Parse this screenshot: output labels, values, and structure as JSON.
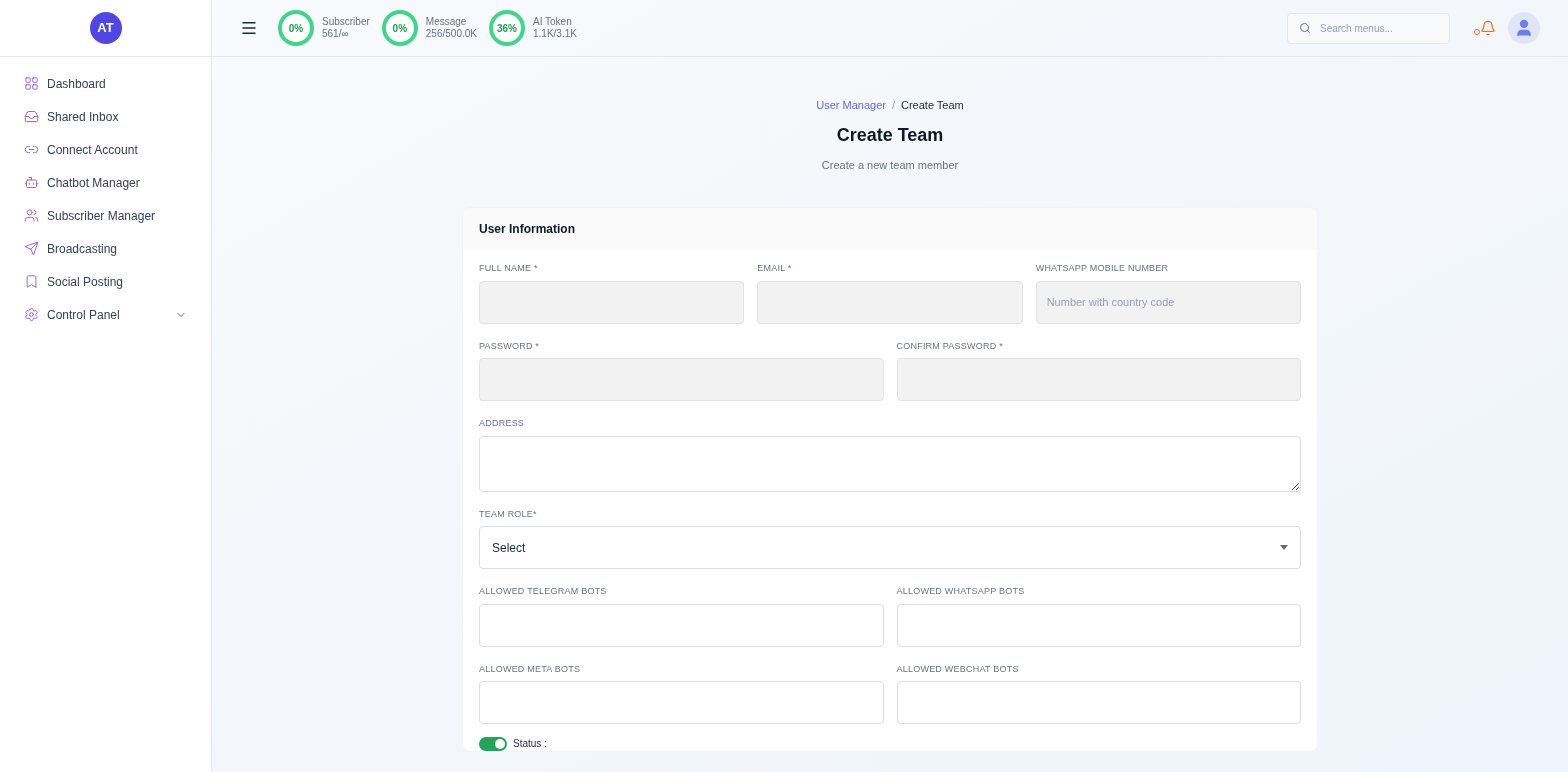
{
  "sidebar": {
    "avatar": "AT",
    "items": [
      {
        "label": "Dashboard",
        "expandable": false
      },
      {
        "label": "Shared Inbox",
        "expandable": false
      },
      {
        "label": "Connect Account",
        "expandable": false
      },
      {
        "label": "Chatbot Manager",
        "expandable": false
      },
      {
        "label": "Subscriber Manager",
        "expandable": false
      },
      {
        "label": "Broadcasting",
        "expandable": false
      },
      {
        "label": "Social Posting",
        "expandable": false
      },
      {
        "label": "Control Panel",
        "expandable": true
      }
    ]
  },
  "header": {
    "stats": [
      {
        "percent": "0%",
        "label": "Subscriber",
        "value": "561/∞"
      },
      {
        "percent": "0%",
        "label": "Message",
        "value": "256/500.0K"
      },
      {
        "percent": "36%",
        "label": "AI Token",
        "value": "1.1K/3.1K"
      }
    ],
    "search": {
      "placeholder": "Search menus..."
    }
  },
  "breadcrumb": [
    {
      "label": "User Manager",
      "link": true
    },
    {
      "label": "Create Team",
      "link": false
    }
  ],
  "breadcrumb_separator": "/",
  "title": "Create Team",
  "subtitle": "Create a new team member",
  "card": {
    "title": "User Information",
    "rows": [
      [
        {
          "label": "FULL NAME *",
          "kind": "input",
          "filled": true
        },
        {
          "label": "EMAIL *",
          "kind": "input",
          "filled": true
        },
        {
          "label": "WHATSAPP MOBILE NUMBER",
          "kind": "input",
          "filled": true,
          "placeholder": "Number with country code"
        }
      ],
      [
        {
          "label": "PASSWORD *",
          "kind": "input",
          "filled": true
        },
        {
          "label": "CONFIRM PASSWORD *",
          "kind": "input",
          "filled": true
        }
      ],
      [
        {
          "label": "ADDRESS",
          "kind": "textarea",
          "filled": false
        }
      ],
      [
        {
          "label": "TEAM ROLE*",
          "kind": "select",
          "filled": false,
          "value": "Select"
        }
      ],
      [
        {
          "label": "ALLOWED TELEGRAM BOTS",
          "kind": "input",
          "filled": false
        },
        {
          "label": "ALLOWED WHATSAPP BOTS",
          "kind": "input",
          "filled": false
        }
      ],
      [
        {
          "label": "ALLOWED META BOTS",
          "kind": "input",
          "filled": false
        },
        {
          "label": "ALLOWED WEBCHAT BOTS",
          "kind": "input",
          "filled": false
        }
      ]
    ],
    "status": {
      "label": "Status :",
      "on": true
    }
  }
}
